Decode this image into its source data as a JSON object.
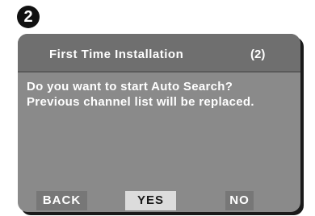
{
  "step_badge": "2",
  "dialog": {
    "title": "First Time Installation",
    "step_indicator": "(2)",
    "message_line1": "Do you want to start Auto Search?",
    "message_line2": "Previous channel list will be replaced."
  },
  "buttons": {
    "back_label": "BACK",
    "yes_label": "YES",
    "no_label": "NO"
  },
  "colors": {
    "screen_bg": "#8a8a8a",
    "title_bar_bg": "#6f6f6f",
    "selected_button_bg": "#dcdcdc",
    "button_bg": "#777777",
    "text": "#ffffff"
  }
}
